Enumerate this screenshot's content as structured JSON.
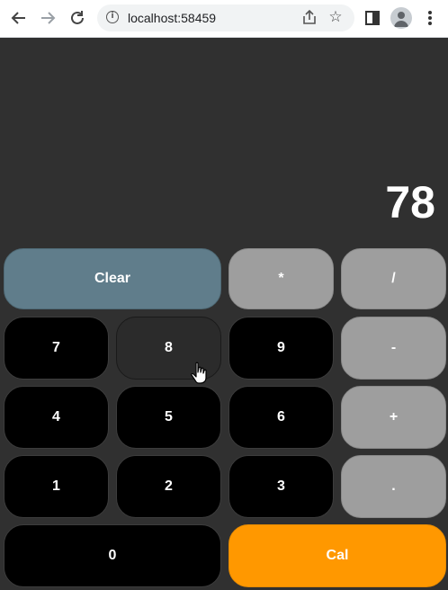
{
  "browser": {
    "url": "localhost:58459",
    "icons": [
      "back-icon",
      "forward-icon",
      "reload-icon",
      "info-icon",
      "share-icon",
      "star-icon",
      "sidebar-icon",
      "profile-icon",
      "menu-icon"
    ]
  },
  "calculator": {
    "display": "78",
    "keys": {
      "clear": "Clear",
      "multiply": "*",
      "divide": "/",
      "seven": "7",
      "eight": "8",
      "nine": "9",
      "minus": "-",
      "four": "4",
      "five": "5",
      "six": "6",
      "plus": "+",
      "one": "1",
      "two": "2",
      "three": "3",
      "dot": ".",
      "zero": "0",
      "calc": "Cal"
    }
  },
  "colors": {
    "background": "#303030",
    "number_key": "#000000",
    "operator_key": "#9e9e9e",
    "clear_key": "#607d8b",
    "calc_key": "#ff9800"
  }
}
